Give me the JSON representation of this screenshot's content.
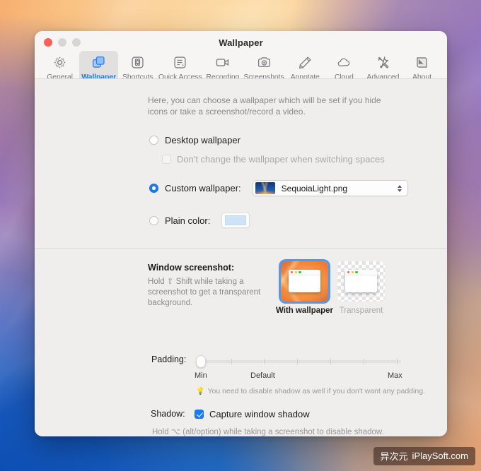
{
  "window": {
    "title": "Wallpaper",
    "traffic_lights": [
      "close",
      "minimize",
      "maximize"
    ]
  },
  "toolbar": {
    "tabs": [
      {
        "label": "General",
        "icon": "gear-icon",
        "selected": false
      },
      {
        "label": "Wallpaper",
        "icon": "layers-icon",
        "selected": true
      },
      {
        "label": "Shortcuts",
        "icon": "command-key-icon",
        "selected": false
      },
      {
        "label": "Quick Access",
        "icon": "quick-access-icon",
        "selected": false
      },
      {
        "label": "Recording",
        "icon": "video-camera-icon",
        "selected": false
      },
      {
        "label": "Screenshots",
        "icon": "camera-icon",
        "selected": false
      },
      {
        "label": "Annotate",
        "icon": "pencil-icon",
        "selected": false
      },
      {
        "label": "Cloud",
        "icon": "cloud-icon",
        "selected": false
      },
      {
        "label": "Advanced",
        "icon": "tools-icon",
        "selected": false
      },
      {
        "label": "About",
        "icon": "curl-page-icon",
        "selected": false
      }
    ]
  },
  "wallpaper_section": {
    "intro": "Here, you can choose a wallpaper which will be set if you hide icons or take a screenshot/record a video.",
    "desktop_wallpaper": {
      "label": "Desktop wallpaper",
      "selected": false
    },
    "dont_change": {
      "label": "Don't change the wallpaper when switching spaces",
      "checked": false,
      "enabled": false
    },
    "custom_wallpaper": {
      "label": "Custom wallpaper:",
      "selected": true,
      "file": "SequoiaLight.png"
    },
    "plain_color": {
      "label": "Plain color:",
      "selected": false,
      "color": "#cfe3f7"
    }
  },
  "window_screenshot": {
    "label": "Window screenshot:",
    "hint": "Hold ⇧ Shift while taking a screenshot to get a transparent background.",
    "options": [
      {
        "caption": "With wallpaper",
        "selected": true
      },
      {
        "caption": "Transparent",
        "selected": false
      }
    ]
  },
  "padding": {
    "label": "Padding:",
    "value_position": "Min",
    "tick_labels": {
      "min": "Min",
      "default": "Default",
      "max": "Max"
    },
    "note": "You need to disable shadow as well if you don't want any padding.",
    "note_icon": "lightbulb-icon"
  },
  "shadow": {
    "label": "Shadow:",
    "checkbox_label": "Capture window shadow",
    "checked": true,
    "hint": "Hold ⌥ (alt/option) while taking a screenshot to disable shadow."
  },
  "watermark": {
    "cn": "异次元",
    "en": "iPlaySoft.com"
  },
  "colors": {
    "accent": "#1b7bf2",
    "selected_tab_bg": "#e2e0de",
    "window_bg": "#efeeec",
    "titlebar_bg": "#f6f5f4"
  }
}
